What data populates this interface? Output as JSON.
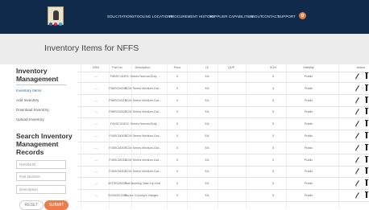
{
  "nav": {
    "items": [
      "SOLICITATIONS",
      "TOOLING LOCATIONS",
      "PROCUREMENT HISTORY",
      "SUPPLIER CAPABILITIES",
      "ABOUT",
      "CONTACT",
      "SUPPORT"
    ],
    "social_icons": [
      "facebook-icon",
      "flickr-icon",
      "twitter-icon"
    ],
    "badge_icon": "user-icon"
  },
  "page": {
    "title": "Inventory Items for NFFS"
  },
  "sidebar": {
    "heading": "Inventory Management",
    "links": [
      "Inventory Items",
      "Add Inventory",
      "Download Inventory",
      "Upload Inventory"
    ],
    "search_heading": "Search Inventory Management Records",
    "inputs": {
      "nsn": "NSN/NIIN",
      "part": "Part Number",
      "desc": "Description"
    },
    "reset_label": "RESET",
    "submit_label": "SUBMIT"
  },
  "table": {
    "headers": [
      "NSN",
      "Part No.",
      "Description",
      "Price",
      "UI",
      "QUP",
      "SOH",
      "Visibility",
      "Action"
    ],
    "rows": [
      [
        "---",
        "F5BSC153",
        "SC Series Normal-Duty ...",
        "0",
        "EA",
        "",
        "5",
        "Public"
      ],
      [
        "---",
        "F5BSCM208",
        "SCM Series Medium-Dut...",
        "0",
        "EA",
        "",
        "4",
        "Public"
      ],
      [
        "---",
        "F5BSCM315",
        "SCM Series Medium-Dut...",
        "0",
        "EA",
        "",
        "5",
        "Public"
      ],
      [
        "---",
        "F5BSCM307",
        "SCM Series Medium-Dut...",
        "0",
        "EA",
        "",
        "5",
        "Public"
      ],
      [
        "---",
        "F45SC315",
        "SC Series Normal-Duty ...",
        "0",
        "EA",
        "",
        "5",
        "Public"
      ],
      [
        "---",
        "F45SCM303",
        "SCM Series Medium-Dut...",
        "0",
        "EA",
        "",
        "5",
        "Public"
      ],
      [
        "---",
        "F45SCM307",
        "SCM Series Medium-Dut...",
        "0",
        "EA",
        "",
        "5",
        "Public"
      ],
      [
        "---",
        "F45SCM315",
        "SCM Series Medium-Dut...",
        "0",
        "EA",
        "",
        "0",
        "Public"
      ],
      [
        "---",
        "F45SCM301",
        "SCM Series Medium-Dut...",
        "0",
        "EA",
        "",
        "5",
        "Public"
      ],
      [
        "---",
        "W3T6S2620T",
        "Ball Bearing Take-Up Unit",
        "0",
        "EA",
        "",
        "5",
        "Public"
      ],
      [
        "---",
        "SCM45C2081",
        "Screw Conveyor Hanger...",
        "0",
        "EA",
        "",
        "5",
        "Public"
      ]
    ]
  },
  "colors": {
    "nav_bg": "#0f2a4a",
    "accent": "#ee7b4a",
    "link": "#2e6da4"
  }
}
